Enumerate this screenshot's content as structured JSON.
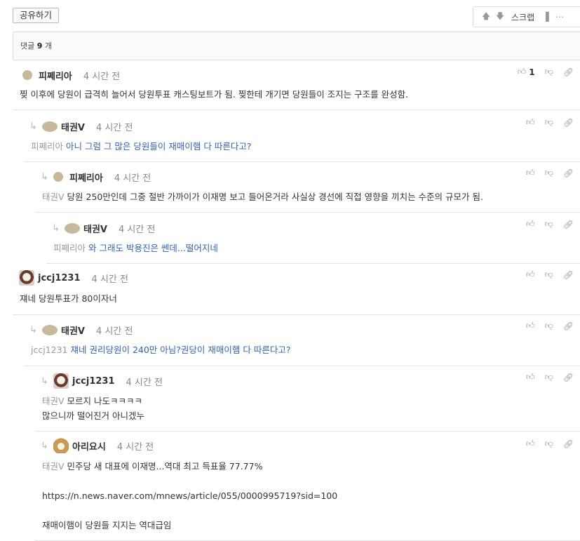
{
  "share_label": "공유하기",
  "toolbar": {
    "scrap_label": "스크랩"
  },
  "comment_count": {
    "label": "댓글",
    "number": "9",
    "suffix": "개"
  },
  "comments": [
    {
      "nick": "피쩨리아",
      "time": "4 시간 전",
      "text": "찢 이후에 당원이 급격히 늘어서 당원투표 캐스팅보트가 됨. 찢한테 개기면 당원들이 조지는 구조를 완성함.",
      "likes": "1"
    },
    {
      "nick": "태권V",
      "time": "4 시간 전",
      "ref": "피쩨리아",
      "text": "아니 그럼 그 많은 당원들이 재매이햄 다 따른다고?"
    },
    {
      "nick": "피쩨리아",
      "time": "4 시간 전",
      "ref": "태권V",
      "text": "당원 250만인데 그중 절반 가까이가 이재명 보고 들어온거라 사실상 경선에 직접 영향을 끼치는 수준의 규모가 됨."
    },
    {
      "nick": "태권V",
      "time": "4 시간 전",
      "ref": "피쩨리아",
      "text": "와 그래도 박용진은 쎈데...떨어지네"
    },
    {
      "nick": "jccj1231",
      "time": "4 시간 전",
      "text": "쟤네 당원투표가 80이자너"
    },
    {
      "nick": "태권V",
      "time": "4 시간 전",
      "ref": "jccj1231",
      "text": "쟤네 권리당원이 240만 아님?권당이 재매이햄 다 따른다고?"
    },
    {
      "nick": "jccj1231",
      "time": "4 시간 전",
      "ref": "태권V",
      "text": "모르지 나도ㅋㅋㅋㅋ",
      "text2": "많으니까 떨어진거 아니겠누"
    },
    {
      "nick": "아리요시",
      "time": "4 시간 전",
      "ref": "태권V",
      "text": "민주당 새 대표에 이재명...역대 최고 득표율 77.77%",
      "text2": "https://n.news.naver.com/mnews/article/055/0000995719?sid=100",
      "text3": "재매이햄이 당원들 지지는 역대급임"
    }
  ]
}
